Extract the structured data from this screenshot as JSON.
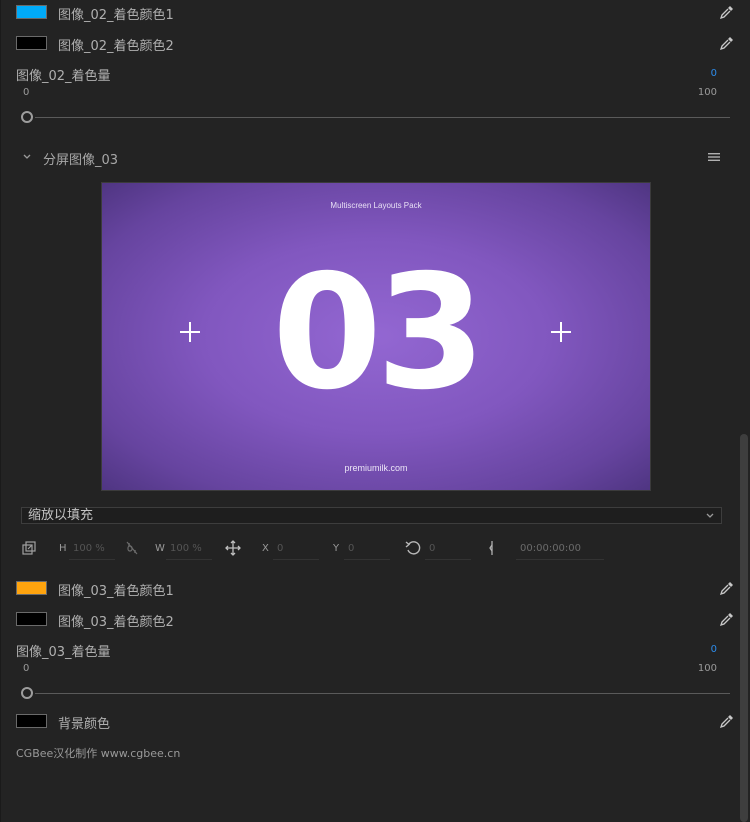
{
  "colors": {
    "image02_color1": "#00aaf8",
    "image02_color2": "#000000",
    "image03_color1": "#ffa40e",
    "image03_color2": "#000000",
    "background_color": "#000000",
    "accent": "#2d8ceb"
  },
  "image02": {
    "color1_label": "图像_02_着色颜色1",
    "color2_label": "图像_02_着色颜色2",
    "amount_label": "图像_02_着色量",
    "amount_value": "0",
    "range_min": "0",
    "range_max": "100",
    "slider_fraction": 0
  },
  "section": {
    "title": "分屏图像_03",
    "chevron_icon": "chevron-down-icon",
    "menu_icon": "hamburger-menu-icon"
  },
  "preview": {
    "title": "Multiscreen Layouts Pack",
    "number": "03",
    "footer": "premiumilk.com"
  },
  "fit_dropdown": {
    "value": "缩放以填充"
  },
  "transform": {
    "h_label": "H",
    "h_value": "100 %",
    "w_label": "W",
    "w_value": "100 %",
    "x_label": "X",
    "x_value": "0",
    "y_label": "Y",
    "y_value": "0",
    "rotation_value": "0",
    "timecode": "00:00:00:00"
  },
  "image03": {
    "color1_label": "图像_03_着色颜色1",
    "color2_label": "图像_03_着色颜色2",
    "amount_label": "图像_03_着色量",
    "amount_value": "0",
    "range_min": "0",
    "range_max": "100",
    "slider_fraction": 0
  },
  "background": {
    "label": "背景颜色"
  },
  "credit": "CGBee汉化制作 www.cgbee.cn"
}
